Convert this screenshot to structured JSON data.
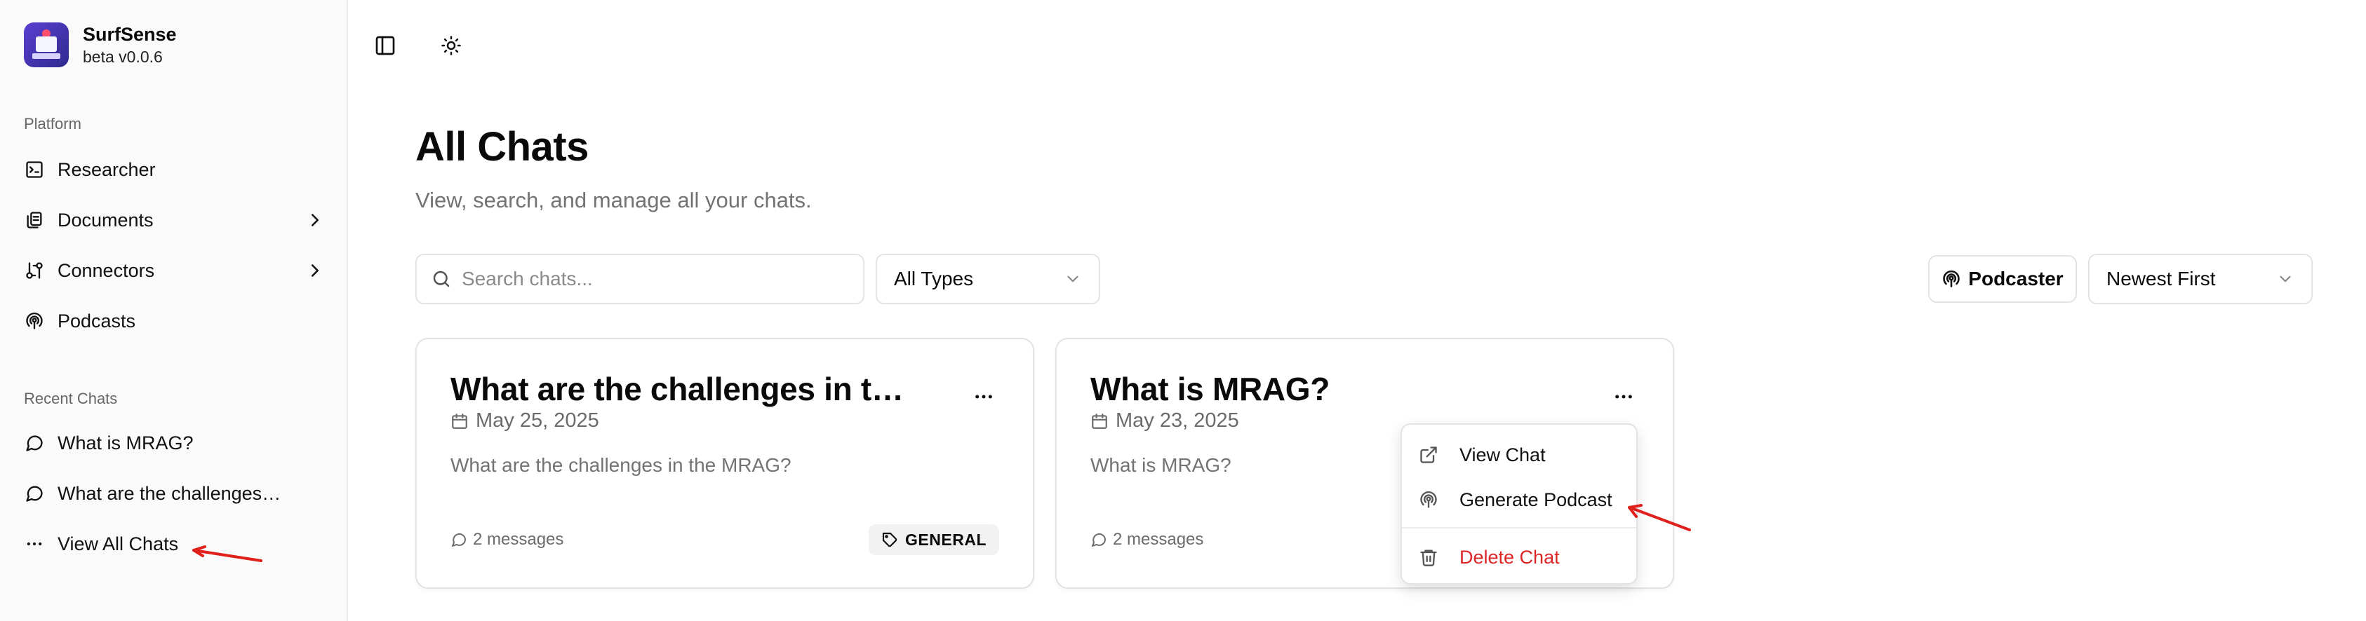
{
  "brand": {
    "name": "SurfSense",
    "version": "beta v0.0.6"
  },
  "sidebar": {
    "platform_label": "Platform",
    "items": [
      {
        "label": "Researcher",
        "icon": "terminal-icon"
      },
      {
        "label": "Documents",
        "icon": "documents-icon",
        "has_submenu": true
      },
      {
        "label": "Connectors",
        "icon": "connectors-icon",
        "has_submenu": true
      },
      {
        "label": "Podcasts",
        "icon": "podcast-icon"
      }
    ],
    "recent_label": "Recent Chats",
    "recent": [
      {
        "label": "What is MRAG?"
      },
      {
        "label": "What are the challenges in the MRAG?"
      },
      {
        "label": "View All Chats"
      }
    ]
  },
  "page": {
    "title": "All Chats",
    "subtitle": "View, search, and manage all your chats."
  },
  "filters": {
    "search_placeholder": "Search chats...",
    "type_value": "All Types",
    "podcaster_label": "Podcaster",
    "sort_value": "Newest First"
  },
  "chats": [
    {
      "title": "What are the challenges in the MRAG?",
      "date": "May 25, 2025",
      "preview": "What are the challenges in the MRAG?",
      "messages": "2 messages",
      "tag": "GENERAL"
    },
    {
      "title": "What is MRAG?",
      "date": "May 23, 2025",
      "preview": "What is MRAG?",
      "messages": "2 messages"
    }
  ],
  "context_menu": {
    "view": "View Chat",
    "podcast": "Generate Podcast",
    "delete": "Delete Chat"
  },
  "colors": {
    "danger": "#dc2626",
    "annotation": "#e0201b",
    "muted": "#737373"
  }
}
